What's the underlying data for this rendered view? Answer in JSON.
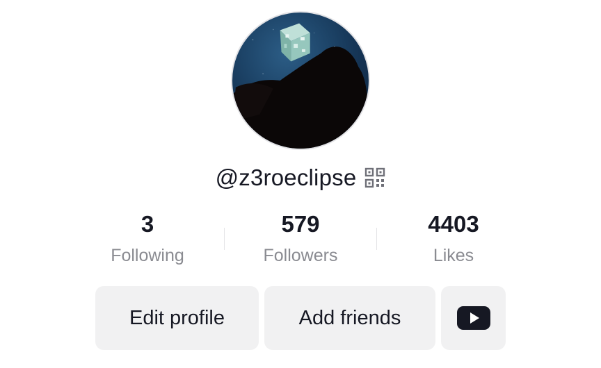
{
  "profile": {
    "username": "@z3roeclipse",
    "avatar_icon": "profile-avatar",
    "qr_icon": "qr-code-icon"
  },
  "stats": [
    {
      "count": "3",
      "label": "Following"
    },
    {
      "count": "579",
      "label": "Followers"
    },
    {
      "count": "4403",
      "label": "Likes"
    }
  ],
  "buttons": {
    "edit_profile": "Edit profile",
    "add_friends": "Add friends",
    "youtube_icon": "youtube-icon"
  },
  "colors": {
    "primary_text": "#161823",
    "secondary_text": "#8a8b91",
    "button_bg": "#f1f1f2",
    "divider": "#e3e3e6"
  }
}
